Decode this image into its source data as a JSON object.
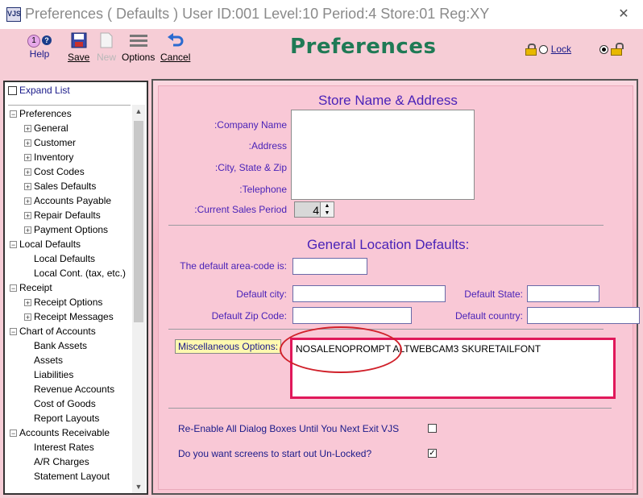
{
  "window": {
    "app_icon_text": "VJS",
    "title": "Preferences ( Defaults )   User ID:001 Level:10 Period:4 Store:01 Reg:XY",
    "close_glyph": "✕"
  },
  "toolbar": {
    "help_badge": "1",
    "help_label": "Help",
    "save_label": "Save",
    "new_label": "New",
    "options_label": "Options",
    "cancel_label": "Cancel",
    "page_title": "Preferences",
    "lock_label": "Lock",
    "lock_selected": false,
    "unlock_selected": true
  },
  "sidebar": {
    "expand_list_label": "Expand List",
    "items": [
      {
        "label": "Preferences",
        "level": 0,
        "expander": "minus"
      },
      {
        "label": "General",
        "level": 1,
        "expander": "plus"
      },
      {
        "label": "Customer",
        "level": 1,
        "expander": "plus"
      },
      {
        "label": "Inventory",
        "level": 1,
        "expander": "plus"
      },
      {
        "label": "Cost Codes",
        "level": 1,
        "expander": "plus"
      },
      {
        "label": "Sales Defaults",
        "level": 1,
        "expander": "plus"
      },
      {
        "label": "Accounts Payable",
        "level": 1,
        "expander": "plus"
      },
      {
        "label": "Repair Defaults",
        "level": 1,
        "expander": "plus"
      },
      {
        "label": "Payment Options",
        "level": 1,
        "expander": "plus"
      },
      {
        "label": "Local Defaults",
        "level": 0,
        "expander": "minus"
      },
      {
        "label": "Local Defaults",
        "level": 1,
        "expander": "none"
      },
      {
        "label": "Local Cont. (tax, etc.)",
        "level": 1,
        "expander": "none"
      },
      {
        "label": "Receipt",
        "level": 0,
        "expander": "minus"
      },
      {
        "label": "Receipt Options",
        "level": 1,
        "expander": "plus"
      },
      {
        "label": "Receipt Messages",
        "level": 1,
        "expander": "plus"
      },
      {
        "label": "Chart of Accounts",
        "level": 0,
        "expander": "minus"
      },
      {
        "label": "Bank Assets",
        "level": 1,
        "expander": "none"
      },
      {
        "label": "Assets",
        "level": 1,
        "expander": "none"
      },
      {
        "label": "Liabilities",
        "level": 1,
        "expander": "none"
      },
      {
        "label": "Revenue Accounts",
        "level": 1,
        "expander": "none"
      },
      {
        "label": "Cost of Goods",
        "level": 1,
        "expander": "none"
      },
      {
        "label": "Report Layouts",
        "level": 1,
        "expander": "none"
      },
      {
        "label": "Accounts Receivable",
        "level": 0,
        "expander": "minus"
      },
      {
        "label": "Interest Rates",
        "level": 1,
        "expander": "none"
      },
      {
        "label": "A/R Charges",
        "level": 1,
        "expander": "none"
      },
      {
        "label": "Statement Layout",
        "level": 1,
        "expander": "none"
      }
    ]
  },
  "store": {
    "section_title": "Store Name & Address",
    "company_name_label": ":Company Name",
    "address_label": ":Address",
    "city_state_zip_label": ":City, State & Zip",
    "telephone_label": ":Telephone",
    "current_sales_period_label": ":Current Sales Period",
    "current_sales_period_value": "4"
  },
  "location": {
    "section_title": "General Location Defaults:",
    "area_code_label": "The default area-code is:",
    "area_code_value": "",
    "city_label": "Default city:",
    "city_value": "",
    "state_label": "Default State:",
    "state_value": "",
    "zip_label": "Default Zip Code:",
    "zip_value": "",
    "country_label": "Default country:",
    "country_value": ""
  },
  "misc": {
    "label": "Miscellaneous Options:",
    "value": "NOSALENOPROMPT  ALTWEBCAM3   SKURETAILFONT"
  },
  "options": {
    "reenable_label": "Re-Enable All Dialog Boxes Until You Next Exit VJS",
    "reenable_checked": false,
    "unlocked_label": "Do you want screens to start out Un-Locked?",
    "unlocked_checked": true
  },
  "colors": {
    "title_green": "#1f7a55",
    "label_purple": "#4a23b8",
    "highlight_red": "#e0185a"
  }
}
